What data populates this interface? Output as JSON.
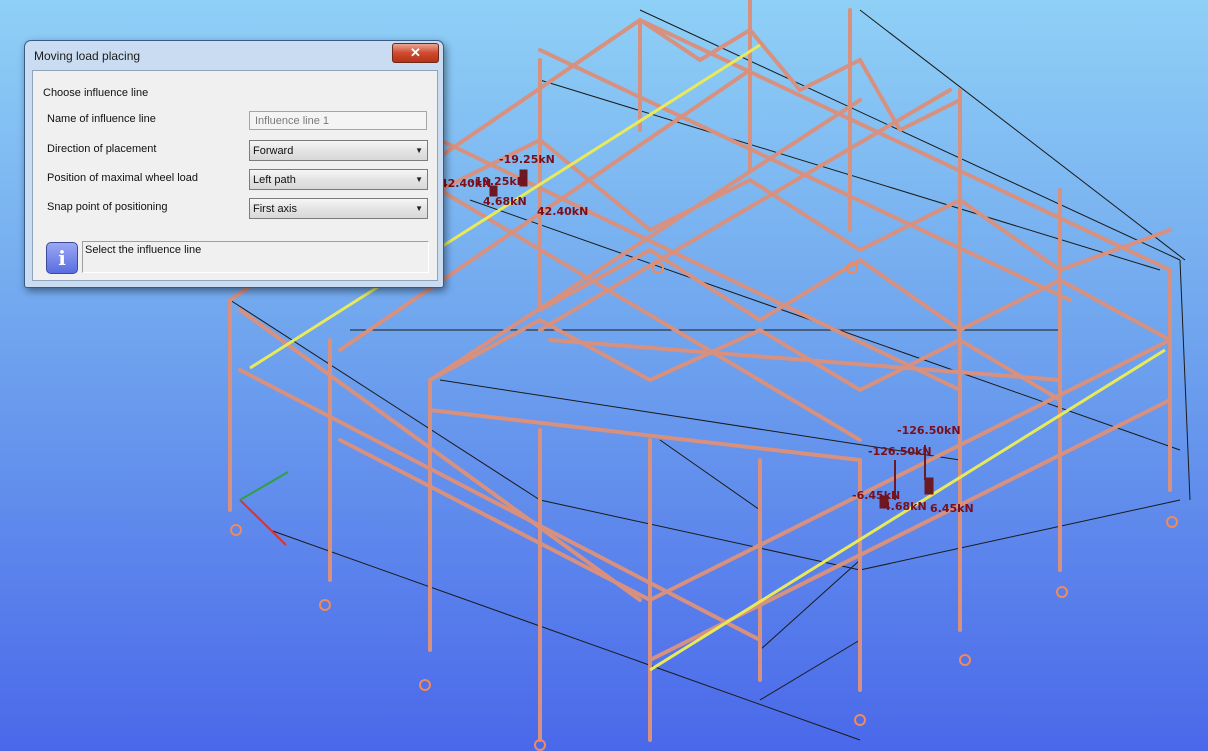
{
  "dialog": {
    "title": "Moving load placing",
    "close_icon": "close-icon",
    "section_label": "Choose influence line",
    "fields": {
      "name_label": "Name of influence line",
      "name_value": "Influence line 1",
      "direction_label": "Direction of placement",
      "direction_value": "Forward",
      "position_label": "Position of maximal wheel load",
      "position_value": "Left path",
      "snap_label": "Snap point of positioning",
      "snap_value": "First axis"
    },
    "info_icon": "info-icon",
    "status_text": "Select the influence line"
  },
  "model": {
    "loads_group1": [
      "-19.25kN",
      "-19.25kN",
      "42.40kN",
      "4.68kN",
      "42.40kN"
    ],
    "loads_group2": [
      "-126.50kN",
      "-126.50kN",
      "-6.45kN",
      "4.68kN",
      "6.45kN"
    ],
    "colors": {
      "member": "#d8907f",
      "bracing": "#1a1a1a",
      "crane_rail": "#e9ea5a",
      "load_label": "#7a0e1a",
      "support": "#f08a5a",
      "background_top": "#8fd0f6",
      "background_bottom": "#4a68ea"
    }
  }
}
